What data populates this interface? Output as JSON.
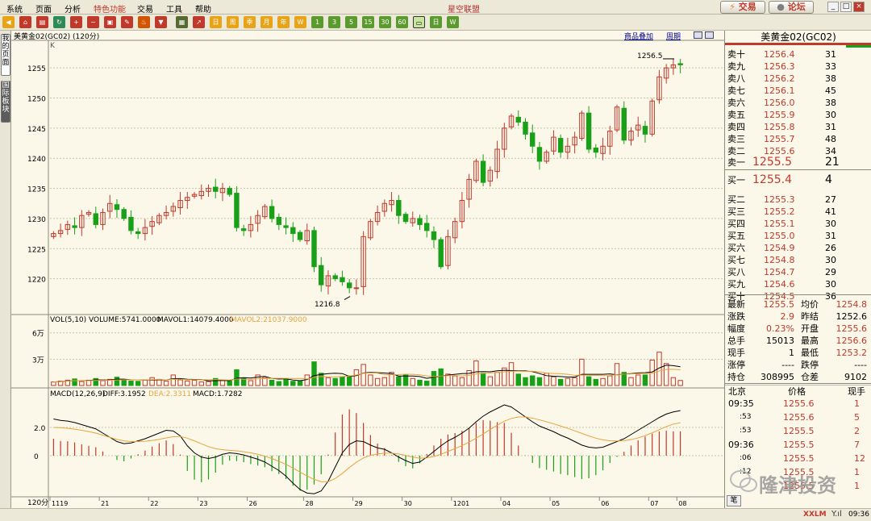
{
  "menubar": {
    "items": [
      "系统",
      "页面",
      "分析",
      "特色功能",
      "交易",
      "工具",
      "帮助"
    ],
    "app_title": "星空联盟",
    "trade_button": "交易",
    "forum_button": "论坛"
  },
  "toolbar": {
    "period_buttons": [
      "W",
      "1",
      "3",
      "5",
      "15",
      "30",
      "60",
      "日",
      "W",
      "M"
    ]
  },
  "left_rail": {
    "tabs": [
      "我的页面",
      "国际板块"
    ]
  },
  "chart": {
    "header": "美黄金02(GC02) (120分)",
    "kind_label": "K",
    "link_overlay": "商品叠加",
    "link_period": "周期",
    "high_label": "1256.5",
    "low_label": "1216.8",
    "volume_header": {
      "vol": "VOL(5,10) VOLUME:5741.0000",
      "mavol1": "MAVOL1:14079.4000",
      "mavol2": "MAVOL2:21037.9000"
    },
    "macd_header": {
      "macd": "MACD(12,26,9)",
      "diff": "DIFF:3.1952",
      "dea": "DEA:2.3311",
      "macd_val": "MACD:1.7282"
    },
    "period_label": "120分",
    "time_labels": [
      "1119",
      "21",
      "22",
      "23",
      "26",
      "28",
      "29",
      "30",
      "1201",
      "04",
      "05",
      "06",
      "07",
      "08"
    ],
    "colors": {
      "up": "#c0392b",
      "down": "#19a019",
      "grid": "#c9c4a4",
      "diff": "#000000",
      "dea": "#e8a33d"
    }
  },
  "chart_data": [
    {
      "type": "candlestick",
      "title": "美黄金02(GC02) (120分)",
      "ylabel": "K",
      "yticks": [
        1220,
        1225,
        1230,
        1235,
        1240,
        1245,
        1250,
        1255
      ],
      "ylim": [
        1215,
        1258.5
      ],
      "xlabels": [
        "1119",
        "21",
        "22",
        "23",
        "26",
        "28",
        "29",
        "30",
        "1201",
        "04",
        "05",
        "06",
        "07",
        "08"
      ],
      "closes": [
        1227.5,
        1228.0,
        1229.0,
        1228.5,
        1230.5,
        1231.0,
        1229.0,
        1231.0,
        1232.5,
        1231.5,
        1230.0,
        1228.0,
        1227.5,
        1228.5,
        1229.5,
        1230.5,
        1231.0,
        1232.0,
        1233.0,
        1233.5,
        1234.0,
        1234.5,
        1235.0,
        1234.5,
        1235.0,
        1234.0,
        1228.5,
        1228.0,
        1229.0,
        1230.5,
        1232.0,
        1230.0,
        1229.0,
        1228.5,
        1227.5,
        1226.5,
        1228.0,
        1222.0,
        1219.0,
        1220.5,
        1220.0,
        1219.5,
        1218.5,
        1218.5,
        1227.0,
        1229.5,
        1231.0,
        1232.5,
        1233.0,
        1230.5,
        1229.5,
        1230.0,
        1229.0,
        1228.0,
        1226.5,
        1222.0,
        1227.0,
        1229.5,
        1233.0,
        1236.5,
        1239.5,
        1236.0,
        1238.0,
        1241.5,
        1245.0,
        1247.0,
        1246.0,
        1244.0,
        1242.0,
        1239.5,
        1241.0,
        1243.5,
        1241.0,
        1242.0,
        1243.5,
        1247.5,
        1241.5,
        1241.0,
        1242.0,
        1244.5,
        1248.5,
        1243.0,
        1244.5,
        1245.5,
        1244.0,
        1249.5,
        1253.5,
        1255.0,
        1255.5,
        1255.5
      ],
      "high": 1256.5,
      "low": 1216.8
    },
    {
      "type": "bar",
      "title": "VOL(5,10)",
      "yticks_labels": [
        "6万",
        "3万"
      ],
      "yticks": [
        60000,
        30000
      ],
      "series": [
        {
          "name": "VOLUME",
          "last": 5741.0
        },
        {
          "name": "MAVOL1",
          "last": 14079.4
        },
        {
          "name": "MAVOL2",
          "last": 21037.9
        }
      ],
      "values": [
        4000,
        5000,
        6000,
        7500,
        4500,
        6000,
        8000,
        5500,
        7000,
        9500,
        6000,
        5000,
        4800,
        6000,
        9000,
        7000,
        5000,
        12000,
        6500,
        5200,
        6000,
        4000,
        4500,
        8000,
        6000,
        5000,
        18000,
        8000,
        5500,
        12000,
        9000,
        6000,
        4500,
        7000,
        4800,
        5500,
        12000,
        27000,
        14000,
        9000,
        8000,
        10000,
        11000,
        18000,
        24000,
        12000,
        8000,
        9000,
        15000,
        10000,
        12000,
        8000,
        6000,
        5000,
        16000,
        19000,
        13000,
        11000,
        9000,
        17000,
        28000,
        14000,
        10000,
        15000,
        20000,
        26000,
        13000,
        9000,
        11000,
        9000,
        14000,
        10000,
        7000,
        8000,
        9000,
        30000,
        10000,
        7000,
        8000,
        11000,
        25000,
        15000,
        9000,
        12000,
        12000,
        29000,
        38000,
        25000,
        9000,
        5741
      ]
    },
    {
      "type": "line",
      "title": "MACD(12,26,9)",
      "yticks": [
        0,
        2.0
      ],
      "series": [
        {
          "name": "DIFF",
          "last": 3.1952
        },
        {
          "name": "DEA",
          "last": 2.3311
        },
        {
          "name": "MACD",
          "last": 1.7282
        }
      ],
      "diff": [
        2.6,
        2.5,
        2.45,
        2.35,
        2.2,
        2.05,
        1.9,
        1.6,
        1.3,
        1.0,
        0.85,
        0.9,
        1.05,
        1.2,
        1.4,
        1.6,
        1.8,
        1.75,
        1.4,
        0.7,
        0.2,
        -0.1,
        -0.2,
        -0.1,
        0.1,
        0.2,
        0.15,
        0.05,
        -0.1,
        -0.25,
        -0.45,
        -0.75,
        -1.05,
        -1.45,
        -1.95,
        -2.4,
        -2.65,
        -2.7,
        -2.5,
        -1.8,
        -0.8,
        0.2,
        0.8,
        1.05,
        1.0,
        0.75,
        0.55,
        0.45,
        0.2,
        -0.1,
        -0.35,
        -0.55,
        -0.45,
        -0.1,
        0.3,
        0.7,
        1.05,
        1.3,
        1.6,
        1.95,
        2.4,
        2.8,
        3.1,
        3.35,
        3.6,
        3.45,
        3.1,
        2.75,
        2.4,
        2.1,
        1.9,
        1.7,
        1.45,
        1.25,
        1.0,
        0.75,
        0.6,
        0.55,
        0.6,
        0.8,
        1.0,
        1.2,
        1.5,
        1.8,
        2.1,
        2.4,
        2.7,
        2.95,
        3.1,
        3.1952
      ],
      "dea": [
        2.0,
        1.98,
        1.94,
        1.88,
        1.8,
        1.7,
        1.6,
        1.45,
        1.3,
        1.15,
        1.05,
        1.0,
        1.0,
        1.02,
        1.08,
        1.16,
        1.26,
        1.34,
        1.36,
        1.24,
        1.05,
        0.84,
        0.64,
        0.5,
        0.42,
        0.38,
        0.34,
        0.28,
        0.2,
        0.1,
        -0.04,
        -0.2,
        -0.4,
        -0.62,
        -0.88,
        -1.16,
        -1.44,
        -1.68,
        -1.84,
        -1.84,
        -1.62,
        -1.26,
        -0.84,
        -0.46,
        -0.16,
        0.02,
        0.12,
        0.18,
        0.18,
        0.12,
        0.02,
        -0.1,
        -0.18,
        -0.16,
        -0.06,
        0.1,
        0.3,
        0.5,
        0.72,
        0.96,
        1.24,
        1.54,
        1.86,
        2.16,
        2.44,
        2.64,
        2.74,
        2.74,
        2.66,
        2.54,
        2.4,
        2.26,
        2.1,
        1.94,
        1.76,
        1.58,
        1.4,
        1.24,
        1.12,
        1.06,
        1.04,
        1.06,
        1.14,
        1.26,
        1.42,
        1.62,
        1.84,
        2.06,
        2.24,
        2.3311
      ]
    }
  ],
  "quote": {
    "title": "美黄金02(GC02)",
    "asks": [
      {
        "label": "卖十",
        "price": "1256.4",
        "vol": "31"
      },
      {
        "label": "卖九",
        "price": "1256.3",
        "vol": "33"
      },
      {
        "label": "卖八",
        "price": "1256.2",
        "vol": "38"
      },
      {
        "label": "卖七",
        "price": "1256.1",
        "vol": "45"
      },
      {
        "label": "卖六",
        "price": "1256.0",
        "vol": "38"
      },
      {
        "label": "卖五",
        "price": "1255.9",
        "vol": "30"
      },
      {
        "label": "卖四",
        "price": "1255.8",
        "vol": "31"
      },
      {
        "label": "卖三",
        "price": "1255.7",
        "vol": "48"
      },
      {
        "label": "卖二",
        "price": "1255.6",
        "vol": "34"
      },
      {
        "label": "卖一",
        "price": "1255.5",
        "vol": "21"
      }
    ],
    "bids": [
      {
        "label": "买一",
        "price": "1255.4",
        "vol": "4"
      },
      {
        "label": "买二",
        "price": "1255.3",
        "vol": "27"
      },
      {
        "label": "买三",
        "price": "1255.2",
        "vol": "41"
      },
      {
        "label": "买四",
        "price": "1255.1",
        "vol": "30"
      },
      {
        "label": "买五",
        "price": "1255.0",
        "vol": "31"
      },
      {
        "label": "买六",
        "price": "1254.9",
        "vol": "26"
      },
      {
        "label": "买七",
        "price": "1254.8",
        "vol": "30"
      },
      {
        "label": "买八",
        "price": "1254.7",
        "vol": "29"
      },
      {
        "label": "买九",
        "price": "1254.6",
        "vol": "30"
      },
      {
        "label": "买十",
        "price": "1254.5",
        "vol": "36"
      }
    ],
    "stats": [
      {
        "k1": "最新",
        "v1": "1255.5",
        "c1": "#c0392b",
        "k2": "均价",
        "v2": "1254.8",
        "c2": "#c0392b"
      },
      {
        "k1": "涨跌",
        "v1": "2.9",
        "c1": "#c0392b",
        "k2": "昨结",
        "v2": "1252.6",
        "c2": "#000000"
      },
      {
        "k1": "幅度",
        "v1": "0.23%",
        "c1": "#c0392b",
        "k2": "开盘",
        "v2": "1255.6",
        "c2": "#c0392b"
      },
      {
        "k1": "总手",
        "v1": "15013",
        "c1": "#000000",
        "k2": "最高",
        "v2": "1256.6",
        "c2": "#c0392b"
      },
      {
        "k1": "现手",
        "v1": "1",
        "c1": "#000000",
        "k2": "最低",
        "v2": "1253.2",
        "c2": "#c0392b"
      },
      {
        "k1": "涨停",
        "v1": "----",
        "c1": "#000000",
        "k2": "跌停",
        "v2": "----",
        "c2": "#000000"
      },
      {
        "k1": "持仓",
        "v1": "308995",
        "c1": "#000000",
        "k2": "仓差",
        "v2": "9102",
        "c2": "#000000"
      }
    ],
    "ticks_header": {
      "time": "北京",
      "price": "价格",
      "qty": "现手"
    },
    "ticks": [
      {
        "time": "09:35",
        "price": "1255.6",
        "qty": "1"
      },
      {
        "time": ":53",
        "price": "1255.6",
        "qty": "5"
      },
      {
        "time": ":53",
        "price": "1255.5",
        "qty": "2"
      },
      {
        "time": "09:36",
        "price": "1255.5",
        "qty": "7"
      },
      {
        "time": ":06",
        "price": "1255.5",
        "qty": "12"
      },
      {
        "time": ":12",
        "price": "1255.5",
        "qty": "1"
      },
      {
        "time": "",
        "price": "1255.5",
        "qty": "1"
      }
    ],
    "tick_tab": "笔"
  },
  "statusbar": {
    "brand": "XXLM",
    "time": "09:36"
  },
  "watermark": {
    "text": "隆津投资"
  }
}
